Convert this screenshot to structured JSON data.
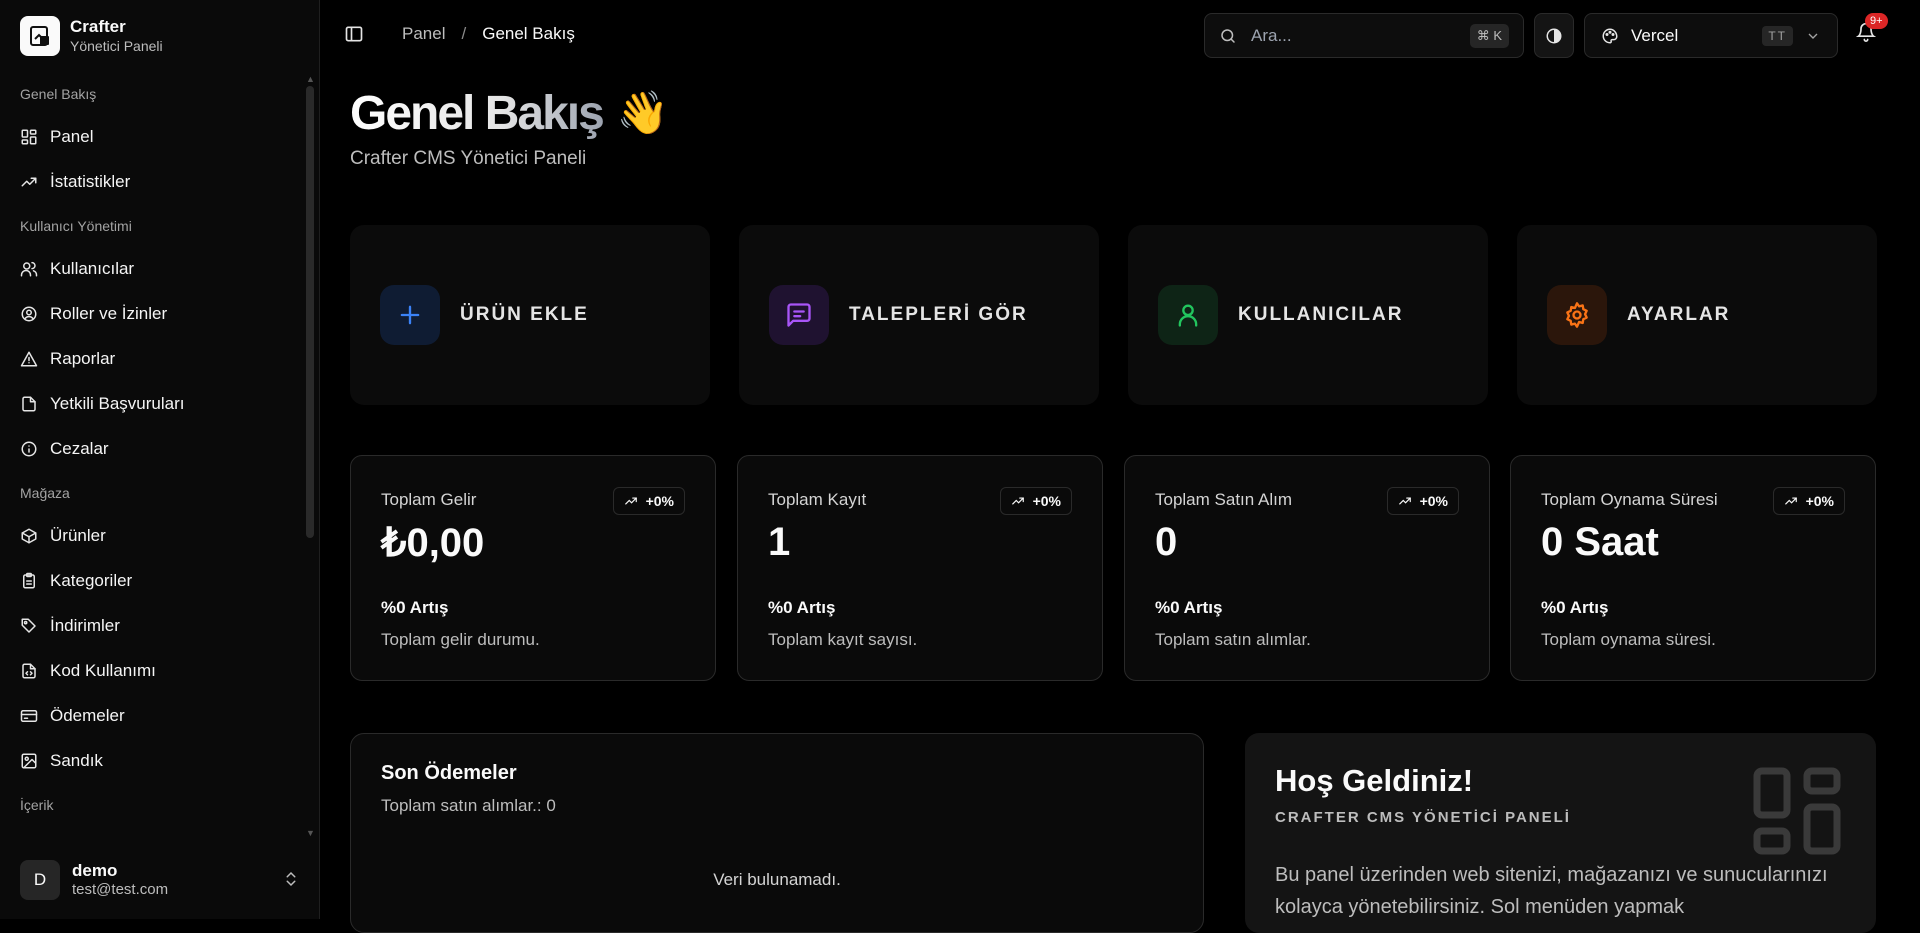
{
  "brand": {
    "title": "Crafter",
    "subtitle": "Yönetici Paneli"
  },
  "sidebar": {
    "groups": [
      {
        "label": "Genel Bakış",
        "items": [
          {
            "label": "Panel",
            "icon": "layout-grid-icon"
          },
          {
            "label": "İstatistikler",
            "icon": "trending-up-icon"
          }
        ]
      },
      {
        "label": "Kullanıcı Yönetimi",
        "items": [
          {
            "label": "Kullanıcılar",
            "icon": "users-icon"
          },
          {
            "label": "Roller ve İzinler",
            "icon": "user-circle-icon"
          },
          {
            "label": "Raporlar",
            "icon": "alert-triangle-icon"
          },
          {
            "label": "Yetkili Başvuruları",
            "icon": "file-icon"
          },
          {
            "label": "Cezalar",
            "icon": "info-icon"
          }
        ]
      },
      {
        "label": "Mağaza",
        "items": [
          {
            "label": "Ürünler",
            "icon": "box-icon"
          },
          {
            "label": "Kategoriler",
            "icon": "clipboard-icon"
          },
          {
            "label": "İndirimler",
            "icon": "tag-icon"
          },
          {
            "label": "Kod Kullanımı",
            "icon": "file-code-icon"
          },
          {
            "label": "Ödemeler",
            "icon": "credit-card-icon"
          },
          {
            "label": "Sandık",
            "icon": "image-icon"
          }
        ]
      },
      {
        "label": "İçerik",
        "items": []
      }
    ]
  },
  "user": {
    "initial": "D",
    "name": "demo",
    "email": "test@test.com"
  },
  "topbar": {
    "breadcrumb": {
      "parent": "Panel",
      "separator": "/",
      "current": "Genel Bakış"
    },
    "search": {
      "placeholder": "Ara...",
      "shortcut_symbol": "⌘",
      "shortcut_key": "K"
    },
    "team": {
      "name": "Vercel",
      "badge": "TT"
    },
    "notifications": {
      "count": "9+"
    }
  },
  "page": {
    "title": "Genel Bakış",
    "emoji": "👋",
    "subtitle": "Crafter CMS Yönetici Paneli"
  },
  "quick_actions": [
    {
      "label": "ÜRÜN EKLE",
      "icon": "plus-icon",
      "color": "#3b82f6",
      "bg": "#0f1c33"
    },
    {
      "label": "TALEPLERİ GÖR",
      "icon": "message-square-icon",
      "color": "#a855f7",
      "bg": "#1f1230"
    },
    {
      "label": "KULLANICILAR",
      "icon": "user-icon",
      "color": "#22c55e",
      "bg": "#0e2416"
    },
    {
      "label": "AYARLAR",
      "icon": "settings-icon",
      "color": "#f97316",
      "bg": "#2b160b"
    }
  ],
  "stats": [
    {
      "title": "Toplam Gelir",
      "badge": "+0%",
      "value": "₺0,00",
      "trend": "%0 Artış",
      "desc": "Toplam gelir durumu."
    },
    {
      "title": "Toplam Kayıt",
      "badge": "+0%",
      "value": "1",
      "trend": "%0 Artış",
      "desc": "Toplam kayıt sayısı."
    },
    {
      "title": "Toplam Satın Alım",
      "badge": "+0%",
      "value": "0",
      "trend": "%0 Artış",
      "desc": "Toplam satın alımlar."
    },
    {
      "title": "Toplam Oynama Süresi",
      "badge": "+0%",
      "value": "0 Saat",
      "trend": "%0 Artış",
      "desc": "Toplam oynama süresi."
    }
  ],
  "recent_payments": {
    "title": "Son Ödemeler",
    "subtitle": "Toplam satın alımlar.: 0",
    "empty": "Veri bulunamadı."
  },
  "welcome": {
    "title": "Hoş Geldiniz!",
    "subtitle": "CRAFTER CMS YÖNETİCİ PANELİ",
    "body": "Bu panel üzerinden web sitenizi, mağazanızı ve sunucularınızı kolayca yönetebilirsiniz. Sol menüden yapmak"
  }
}
